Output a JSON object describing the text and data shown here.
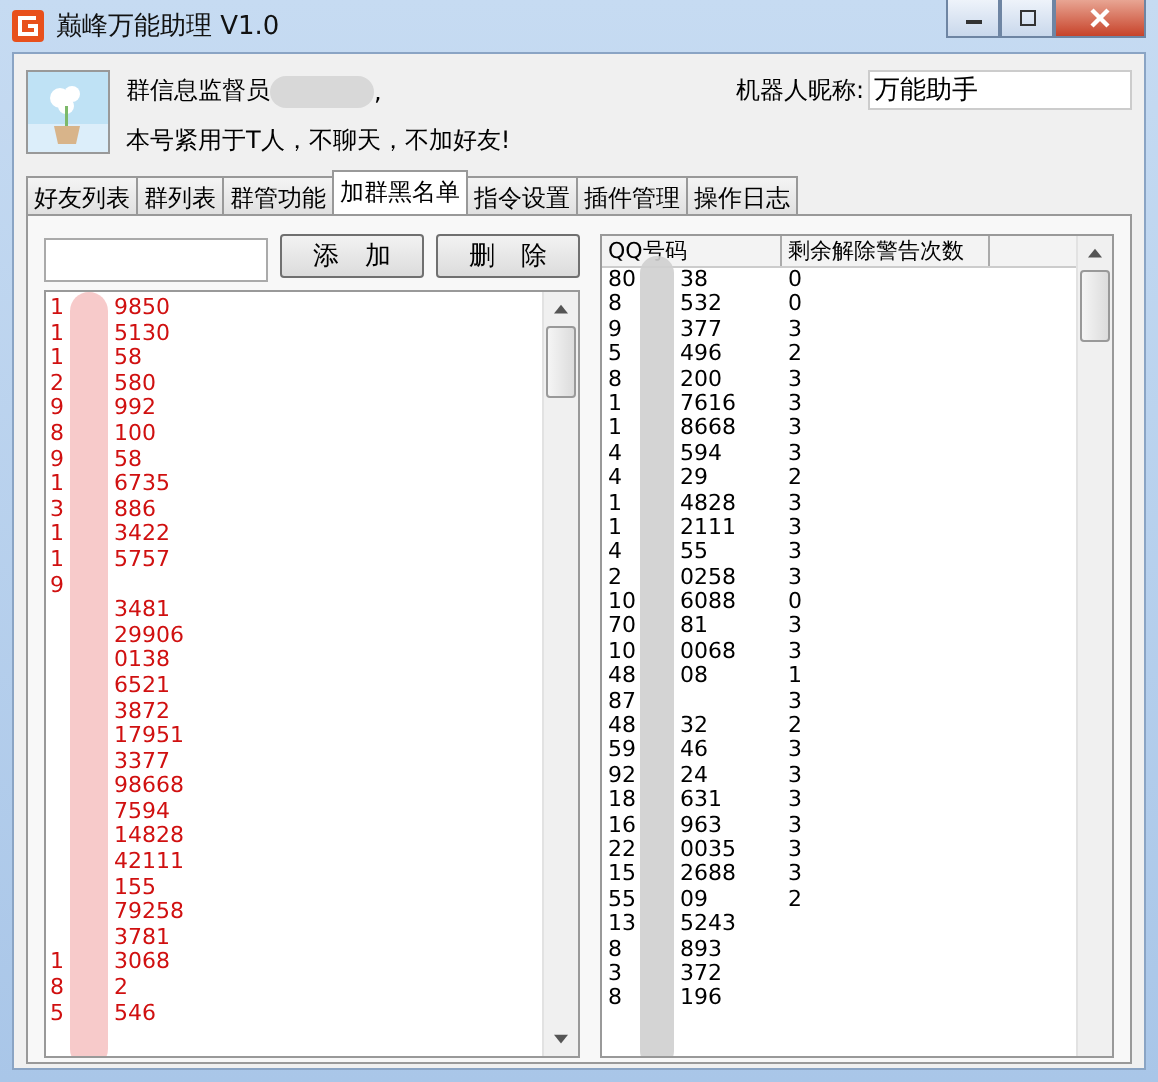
{
  "window": {
    "title": "巅峰万能助理 V1.0"
  },
  "profile": {
    "name": "群信息监督员",
    "tail": ",",
    "motto": "本号紧用于T人，不聊天，不加好友!",
    "nickname_label": "机器人昵称:",
    "nickname": "万能助手"
  },
  "tabs": [
    {
      "label": "好友列表",
      "selected": false
    },
    {
      "label": "群列表",
      "selected": false
    },
    {
      "label": "群管功能",
      "selected": false
    },
    {
      "label": "加群黑名单",
      "selected": true
    },
    {
      "label": "指令设置",
      "selected": false
    },
    {
      "label": "插件管理",
      "selected": false
    },
    {
      "label": "操作日志",
      "selected": false
    }
  ],
  "buttons": [
    "添　加",
    "删　除"
  ],
  "blacklist": [
    {
      "start": "1",
      "end": "9850"
    },
    {
      "start": "1",
      "end": "5130"
    },
    {
      "start": "1",
      "end": "58"
    },
    {
      "start": "2",
      "end": "580"
    },
    {
      "start": "9",
      "end": "992"
    },
    {
      "start": "8",
      "end": "100"
    },
    {
      "start": "9",
      "end": "58"
    },
    {
      "start": "1",
      "end": "6735"
    },
    {
      "start": "3",
      "end": "886"
    },
    {
      "start": "1",
      "end": "3422"
    },
    {
      "start": "1",
      "end": "5757"
    },
    {
      "start": "9"
    },
    {
      "end": "3481"
    },
    {
      "end": "29906"
    },
    {
      "end": "0138"
    },
    {
      "end": "6521"
    },
    {
      "end": "3872"
    },
    {
      "end": "17951"
    },
    {
      "end": "3377"
    },
    {
      "end": "98668"
    },
    {
      "end": "7594"
    },
    {
      "end": "14828"
    },
    {
      "end": "42111"
    },
    {
      "end": "155"
    },
    {
      "end": "79258"
    },
    {
      "end": "3781"
    },
    {
      "start": "1",
      "end": "3068"
    },
    {
      "start": "8",
      "end": "2"
    },
    {
      "start": "5",
      "end": "546"
    }
  ],
  "table": {
    "columns": [
      "QQ号码",
      "剩余解除警告次数"
    ],
    "rows": [
      {
        "start": "80",
        "end": "38",
        "count": "0"
      },
      {
        "start": "8",
        "end": "532",
        "count": "0"
      },
      {
        "start": "9",
        "end": "377",
        "count": "3"
      },
      {
        "start": "5",
        "end": "496",
        "count": "2"
      },
      {
        "start": "8",
        "end": "200",
        "count": "3"
      },
      {
        "start": "1",
        "end": "7616",
        "count": "3"
      },
      {
        "start": "1",
        "end": "8668",
        "count": "3"
      },
      {
        "start": "4",
        "end": "594",
        "count": "3"
      },
      {
        "start": "4",
        "end": "29",
        "count": "2"
      },
      {
        "start": "1",
        "end": "4828",
        "count": "3"
      },
      {
        "start": "1",
        "end": "2111",
        "count": "3"
      },
      {
        "start": "4",
        "end": "55",
        "count": "3"
      },
      {
        "start": "2",
        "end": "0258",
        "count": "3"
      },
      {
        "start": "10",
        "end": "6088",
        "count": "0"
      },
      {
        "start": "70",
        "end": "81",
        "count": "3"
      },
      {
        "start": "10",
        "end": "0068",
        "count": "3"
      },
      {
        "start": "48",
        "end": "08",
        "count": "1"
      },
      {
        "start": "87",
        "count": "3"
      },
      {
        "start": "48",
        "end": "32",
        "count": "2"
      },
      {
        "start": "59",
        "end": "46",
        "count": "3"
      },
      {
        "start": "92",
        "end": "24",
        "count": "3"
      },
      {
        "start": "18",
        "end": "631",
        "count": "3"
      },
      {
        "start": "16",
        "end": "963",
        "count": "3"
      },
      {
        "start": "22",
        "end": "0035",
        "count": "3"
      },
      {
        "start": "15",
        "end": "2688",
        "count": "3"
      },
      {
        "start": "55",
        "end": "09",
        "count": "2"
      },
      {
        "start": "13",
        "end": "5243"
      },
      {
        "start": "8",
        "end": "893"
      },
      {
        "start": "3",
        "end": "372"
      },
      {
        "start": "8",
        "end": "196"
      }
    ]
  }
}
